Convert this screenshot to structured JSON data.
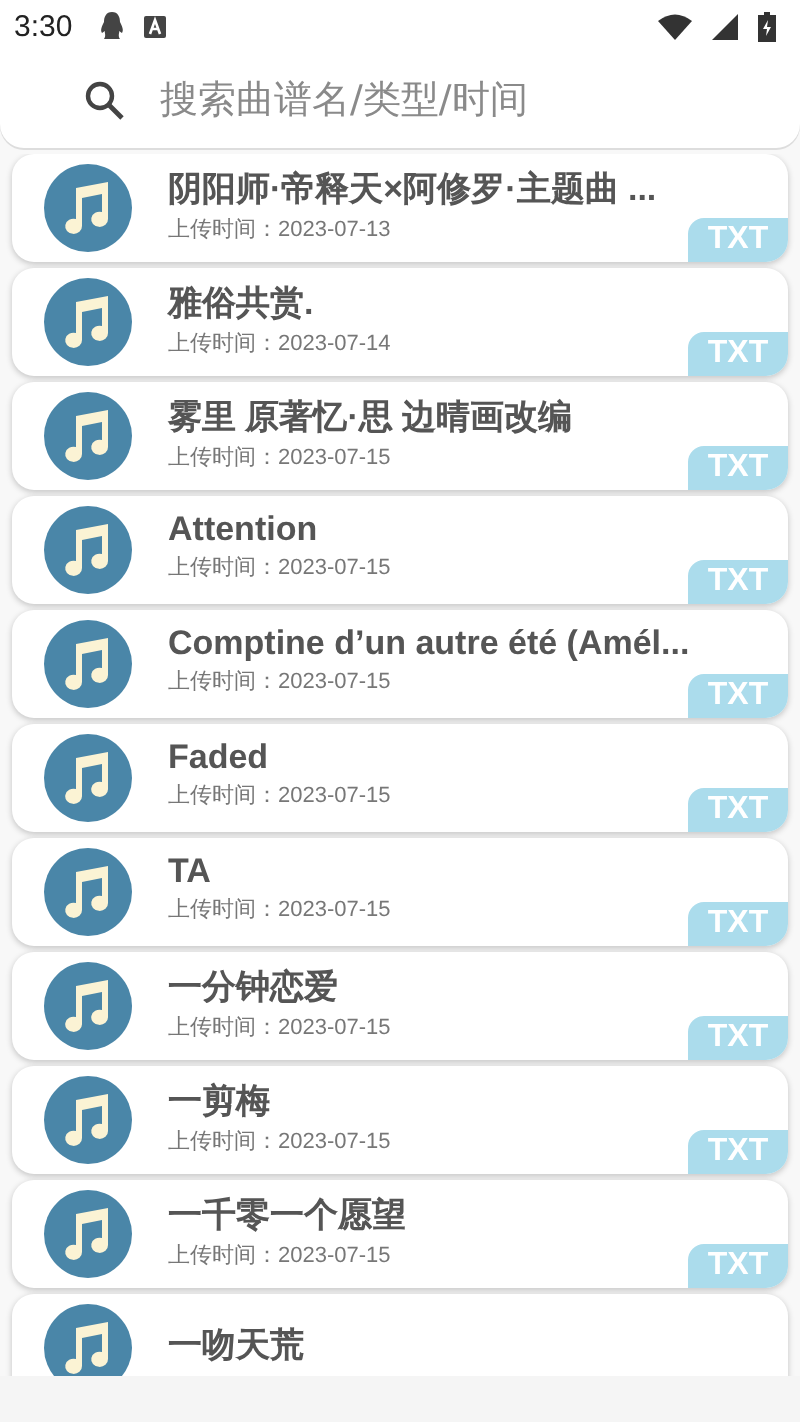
{
  "status_bar": {
    "time": "3:30"
  },
  "search": {
    "placeholder": "搜索曲谱名/类型/时间"
  },
  "items": [
    {
      "title": "阴阳师·帝释天×阿修罗·主题曲 ...",
      "date": "上传时间：2023-07-13",
      "badge": "TXT"
    },
    {
      "title": "雅俗共赏.",
      "date": "上传时间：2023-07-14",
      "badge": "TXT"
    },
    {
      "title": "雾里  原著忆·思 边晴画改编",
      "date": "上传时间：2023-07-15",
      "badge": "TXT"
    },
    {
      "title": "Attention",
      "date": "上传时间：2023-07-15",
      "badge": "TXT"
    },
    {
      "title": "Comptine d’un autre été (Amél...",
      "date": "上传时间：2023-07-15",
      "badge": "TXT"
    },
    {
      "title": "Faded",
      "date": "上传时间：2023-07-15",
      "badge": "TXT"
    },
    {
      "title": "TA",
      "date": "上传时间：2023-07-15",
      "badge": "TXT"
    },
    {
      "title": "一分钟恋爱",
      "date": "上传时间：2023-07-15",
      "badge": "TXT"
    },
    {
      "title": "一剪梅",
      "date": "上传时间：2023-07-15",
      "badge": "TXT"
    },
    {
      "title": "一千零一个愿望",
      "date": "上传时间：2023-07-15",
      "badge": "TXT"
    },
    {
      "title": "一吻天荒"
    }
  ]
}
